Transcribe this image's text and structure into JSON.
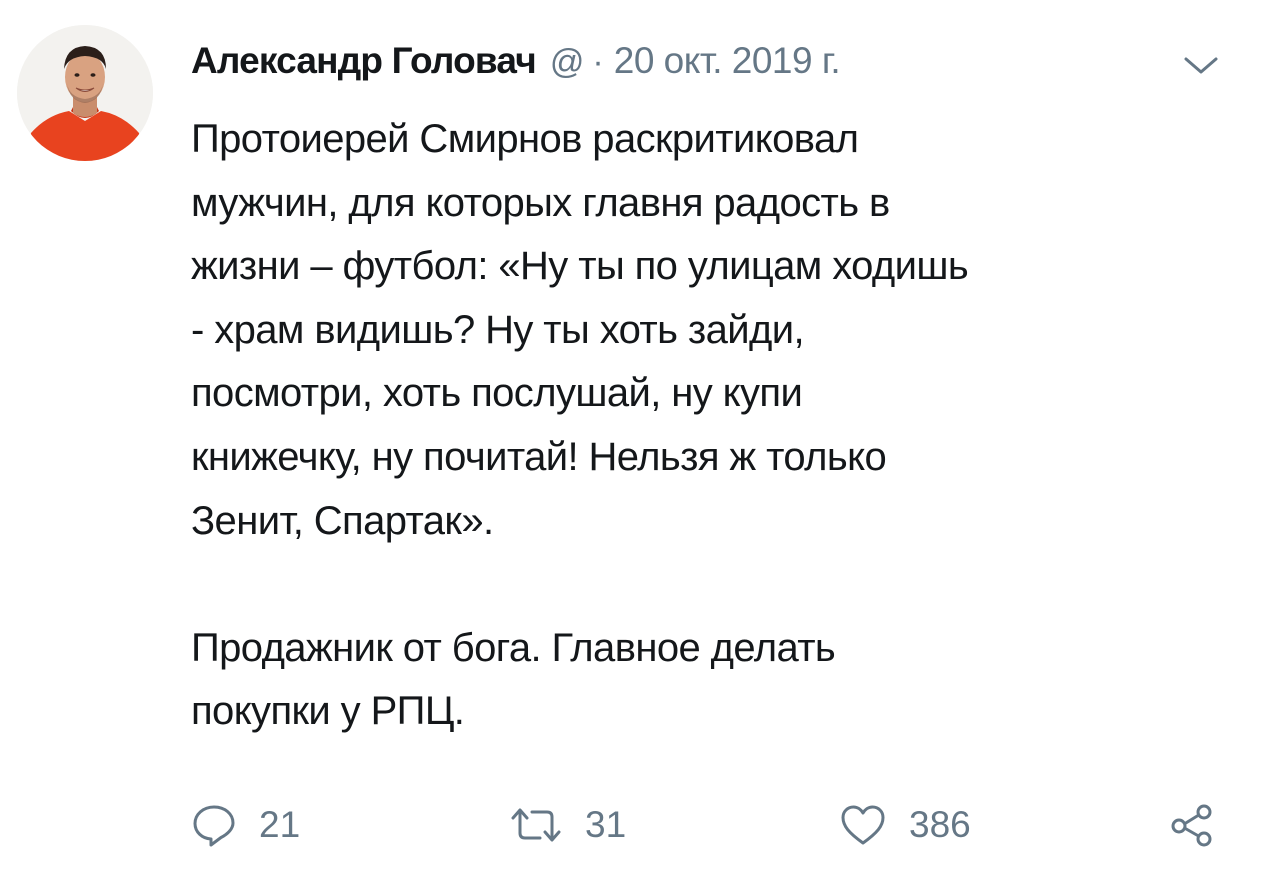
{
  "tweet": {
    "author": {
      "name": "Александр Головач",
      "handle": "@"
    },
    "separator": "·",
    "date": "20 окт. 2019 г.",
    "paragraphs": [
      "Протоиерей Смирнов раскритиковал\nмужчин, для которых главня радость в\nжизни – футбол: «Ну ты по улицам ходишь\n- храм видишь? Ну ты хоть зайди,\nпосмотри, хоть послушай, ну купи\nкнижечку, ну почитай! Нельзя ж только\nЗенит, Спартак».",
      "Продажник от бога. Главное делать\nпокупки у РПЦ."
    ],
    "actions": {
      "replies": "21",
      "retweets": "31",
      "likes": "386"
    }
  },
  "icons": {
    "menu": "chevron-down-icon",
    "reply": "reply-icon",
    "retweet": "retweet-icon",
    "like": "heart-icon",
    "share": "share-icon"
  },
  "colors": {
    "text": "#14171a",
    "secondary": "#657786",
    "avatar_shirt": "#e8431f"
  }
}
